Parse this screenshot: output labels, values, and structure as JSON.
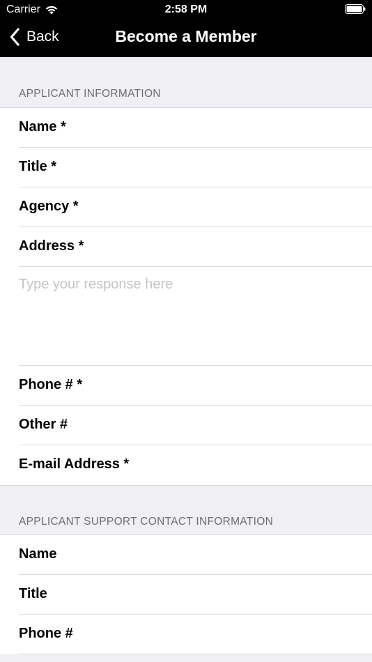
{
  "status_bar": {
    "carrier": "Carrier",
    "time": "2:58 PM"
  },
  "nav": {
    "back_label": "Back",
    "title": "Become a Member"
  },
  "applicant": {
    "header": "APPLICANT INFORMATION",
    "fields": [
      {
        "label": "Name *"
      },
      {
        "label": "Title *"
      },
      {
        "label": "Agency *"
      },
      {
        "label": "Address *"
      }
    ],
    "address_placeholder": "Type your response here",
    "fields_after": [
      {
        "label": "Phone # *"
      },
      {
        "label": "Other #"
      },
      {
        "label": "E-mail Address *"
      }
    ]
  },
  "support": {
    "header": "APPLICANT SUPPORT CONTACT INFORMATION",
    "fields": [
      {
        "label": "Name"
      },
      {
        "label": "Title"
      },
      {
        "label": "Phone #"
      }
    ]
  },
  "colors": {
    "nav_background": "#000000",
    "page_background": "#efeff4",
    "section_header_text": "#6d6d72",
    "placeholder_text": "#c4c4c8"
  },
  "icons": {
    "wifi": "wifi-icon",
    "battery": "battery-icon",
    "back": "chevron-left-icon"
  }
}
